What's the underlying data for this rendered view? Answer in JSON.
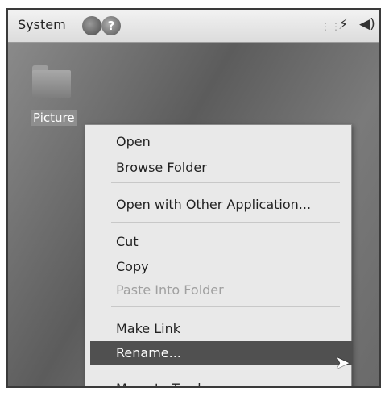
{
  "panel": {
    "system_label": "System",
    "help_symbol": "?",
    "icons": [
      "firefox-icon",
      "help-icon",
      "network-icon",
      "volume-icon"
    ]
  },
  "desktop": {
    "folder_label": "Picture"
  },
  "context_menu": {
    "open": "Open",
    "browse_folder": "Browse Folder",
    "open_with": "Open with Other Application...",
    "cut": "Cut",
    "copy": "Copy",
    "paste_into_folder": "Paste Into Folder",
    "make_link": "Make Link",
    "rename": "Rename...",
    "move_to_trash": "Move to Trash"
  },
  "colors": {
    "selected_item_bg": "#505050",
    "menu_bg": "#e9e9e9",
    "disabled_text": "#a0a0a0"
  }
}
